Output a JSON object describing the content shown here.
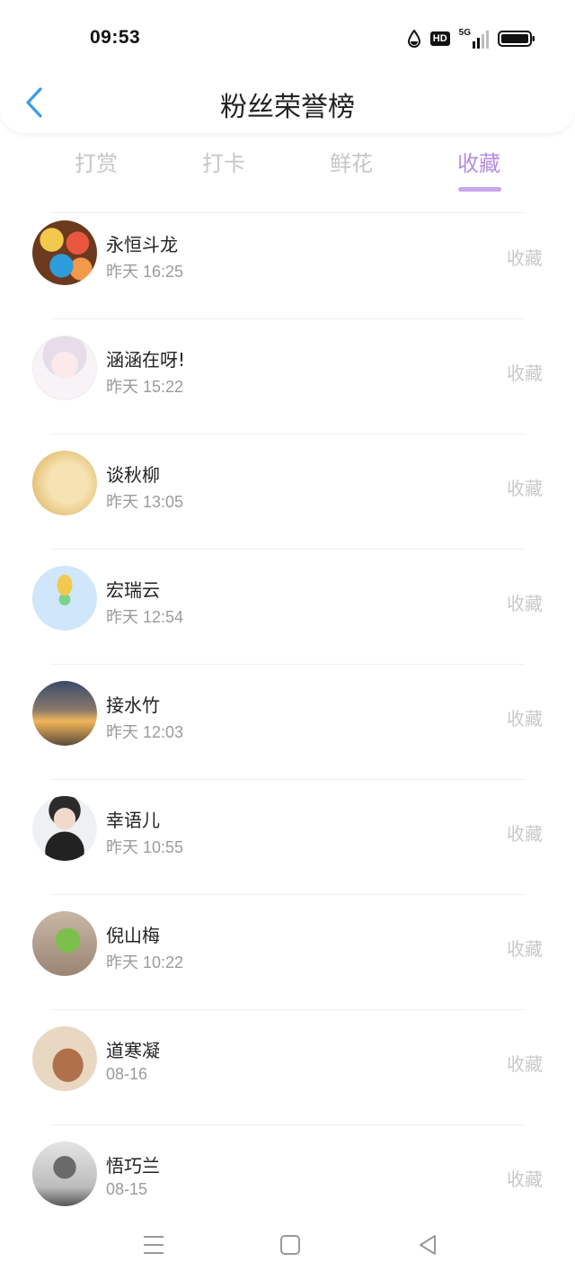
{
  "status_bar": {
    "time": "09:53",
    "hd_label": "HD",
    "network_label": "5G"
  },
  "header": {
    "title": "粉丝荣誉榜"
  },
  "tabs": [
    {
      "label": "打赏",
      "active": false
    },
    {
      "label": "打卡",
      "active": false
    },
    {
      "label": "鲜花",
      "active": false
    },
    {
      "label": "收藏",
      "active": true
    }
  ],
  "list": [
    {
      "name": "永恒斗龙",
      "time": "昨天 16:25",
      "action": "收藏"
    },
    {
      "name": "涵涵在呀!",
      "time": "昨天 15:22",
      "action": "收藏"
    },
    {
      "name": "谈秋柳",
      "time": "昨天 13:05",
      "action": "收藏"
    },
    {
      "name": "宏瑞云",
      "time": "昨天 12:54",
      "action": "收藏"
    },
    {
      "name": "接水竹",
      "time": "昨天 12:03",
      "action": "收藏"
    },
    {
      "name": "幸语儿",
      "time": "昨天 10:55",
      "action": "收藏"
    },
    {
      "name": "倪山梅",
      "time": "昨天 10:22",
      "action": "收藏"
    },
    {
      "name": "道寒凝",
      "time": "08-16",
      "action": "收藏"
    },
    {
      "name": "悟巧兰",
      "time": "08-15",
      "action": "收藏"
    }
  ],
  "colors": {
    "accent": "#b48de0",
    "back_arrow": "#3a9be8",
    "inactive_text": "#c6c6c6"
  }
}
